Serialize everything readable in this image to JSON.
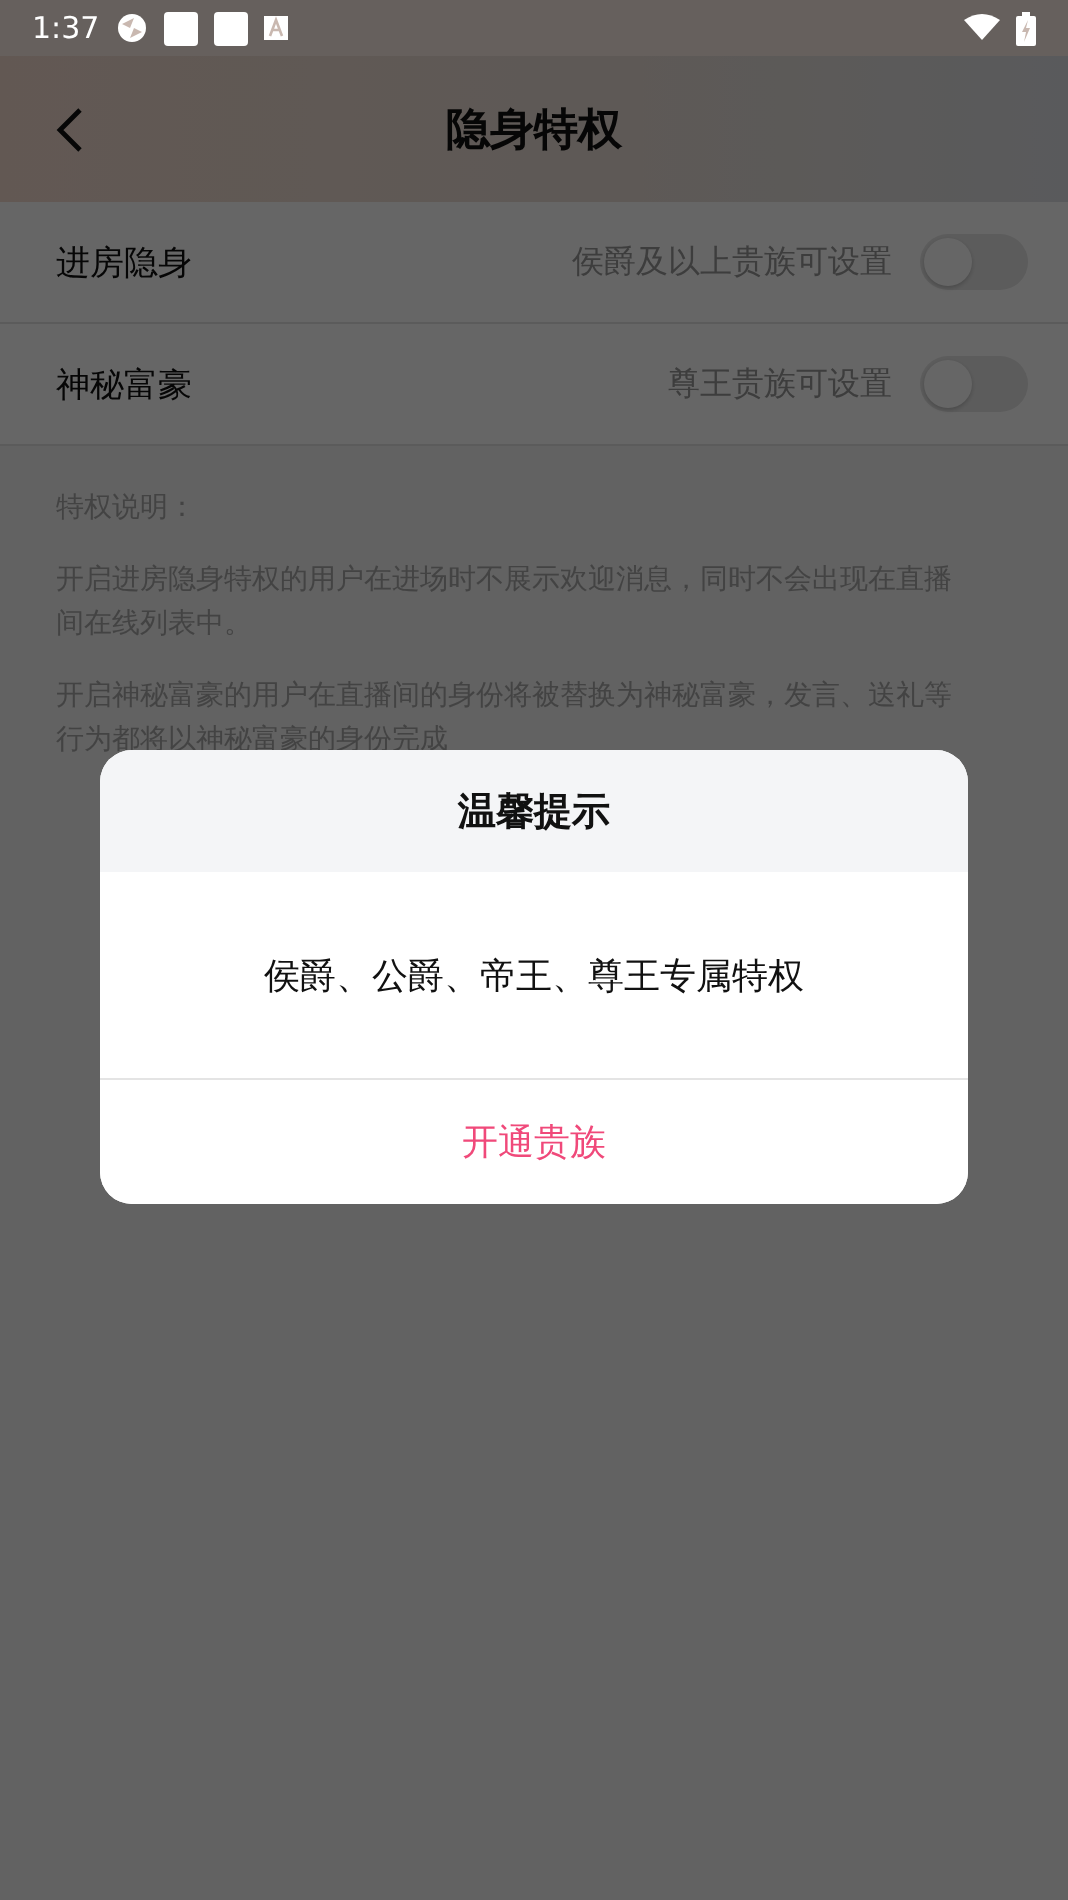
{
  "status_bar": {
    "time": "1:37"
  },
  "header": {
    "title": "隐身特权"
  },
  "settings": [
    {
      "label": "进房隐身",
      "hint": "侯爵及以上贵族可设置",
      "on": false
    },
    {
      "label": "神秘富豪",
      "hint": "尊王贵族可设置",
      "on": false
    }
  ],
  "description": {
    "heading": "特权说明：",
    "paragraphs": [
      "开启进房隐身特权的用户在进场时不展示欢迎消息，同时不会出现在直播间在线列表中。",
      "开启神秘富豪的用户在直播间的身份将被替换为神秘富豪，发言、送礼等行为都将以神秘富豪的身份完成"
    ]
  },
  "dialog": {
    "title": "温馨提示",
    "message": "侯爵、公爵、帝王、尊王专属特权",
    "action": "开通贵族"
  }
}
